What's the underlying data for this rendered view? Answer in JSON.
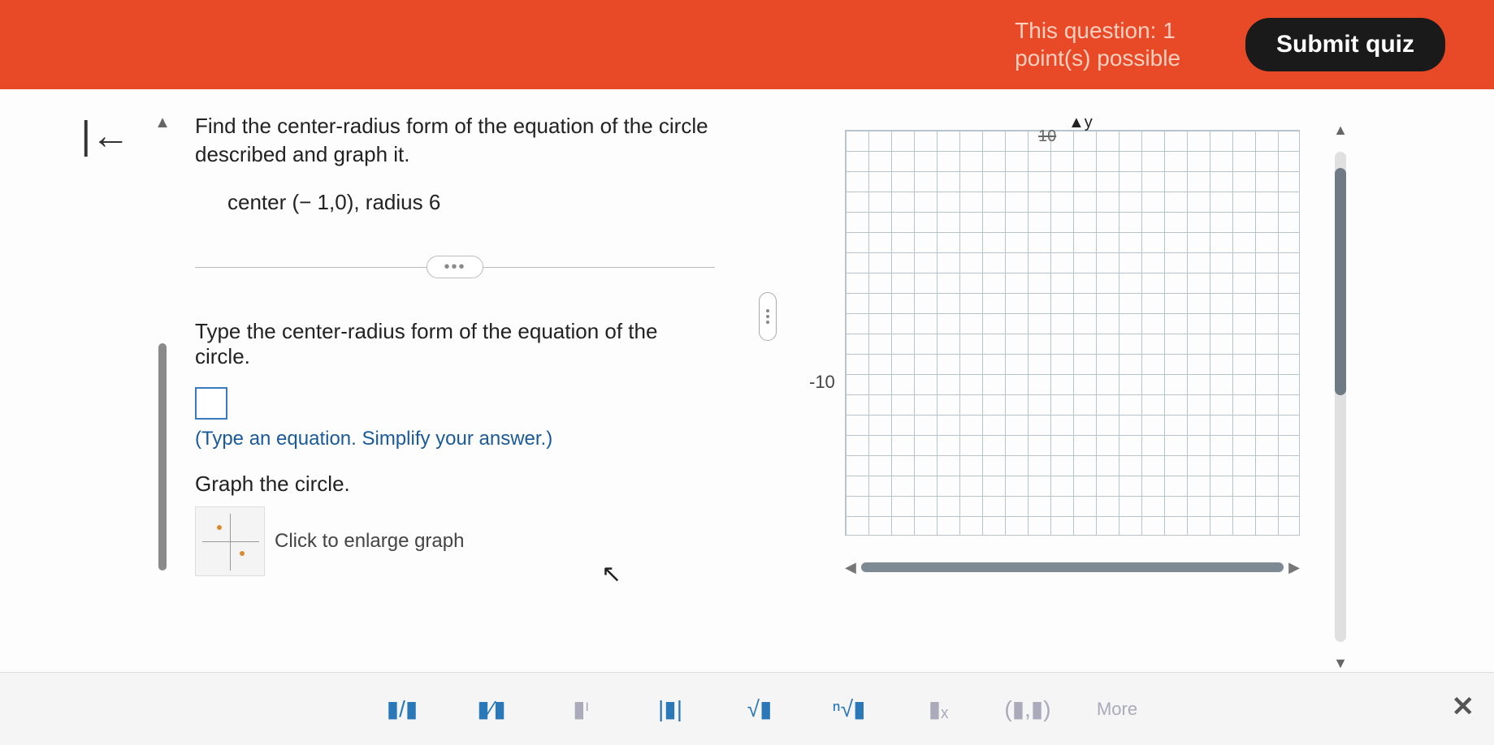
{
  "header": {
    "points_line1": "This question: 1",
    "points_line2": "point(s) possible",
    "submit_label": "Submit quiz"
  },
  "question": {
    "prompt": "Find the center-radius form of the equation of the circle described and graph it.",
    "given": "center (− 1,0), radius 6",
    "instruction": "Type the center-radius form of the equation of the circle.",
    "hint": "(Type an equation. Simplify your answer.)",
    "graph_label": "Graph the circle.",
    "enlarge_text": "Click to enlarge graph"
  },
  "graph": {
    "y_axis_label": "y",
    "y_tick_top": "10",
    "x_tick_left": "-10"
  },
  "toolbar": {
    "frac": "▮/▮",
    "mixed": "▮⁄▮",
    "power": "▮ᶦ",
    "abs": "|▮|",
    "sqrt": "√▮",
    "nroot": "ⁿ√▮",
    "sub": "▮ₓ",
    "paren": "(▮,▮)",
    "more": "More"
  },
  "chart_data": {
    "type": "scatter",
    "title": "",
    "xlabel": "",
    "ylabel": "y",
    "xlim": [
      -10,
      10
    ],
    "ylim": [
      -10,
      10
    ],
    "series": [
      {
        "name": "grid",
        "values": []
      }
    ]
  }
}
